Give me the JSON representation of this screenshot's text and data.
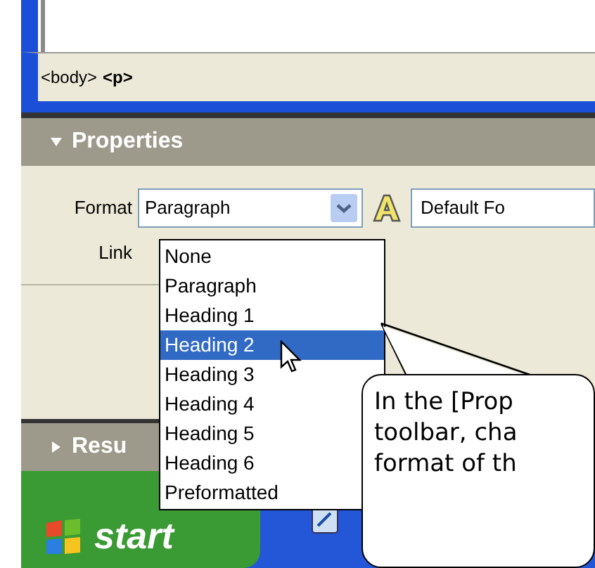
{
  "status_bar": {
    "tags": [
      {
        "text": "<body>",
        "bold": false
      },
      {
        "text": "<p>",
        "bold": true
      }
    ]
  },
  "properties_panel": {
    "title": "Properties",
    "expanded": true,
    "format": {
      "label": "Format",
      "value": "Paragraph"
    },
    "font": {
      "value": "Default Fo"
    },
    "link": {
      "label": "Link"
    },
    "format_menu": [
      {
        "label": "None",
        "selected": false
      },
      {
        "label": "Paragraph",
        "selected": false
      },
      {
        "label": "Heading 1",
        "selected": false
      },
      {
        "label": "Heading 2",
        "selected": true
      },
      {
        "label": "Heading 3",
        "selected": false
      },
      {
        "label": "Heading 4",
        "selected": false
      },
      {
        "label": "Heading 5",
        "selected": false
      },
      {
        "label": "Heading 6",
        "selected": false
      },
      {
        "label": "Preformatted",
        "selected": false
      }
    ]
  },
  "results_panel": {
    "title": "Resu",
    "expanded": false
  },
  "taskbar": {
    "start": "start"
  },
  "callout": {
    "lines": [
      "In the [Prop",
      "toolbar, cha",
      "format of th"
    ]
  }
}
